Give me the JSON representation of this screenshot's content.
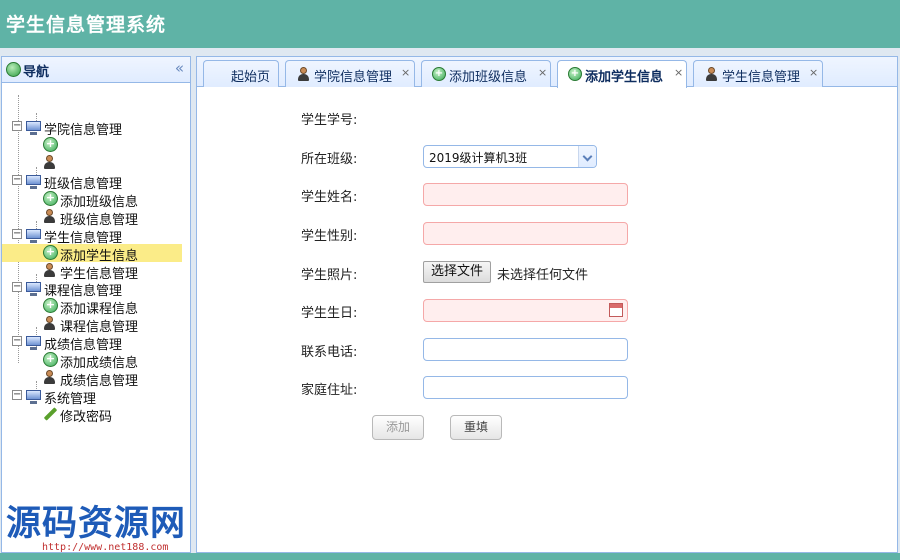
{
  "app": {
    "title": "学生信息管理系统"
  },
  "nav": {
    "title": "导航",
    "collapse_icon": "double-chevron-left-icon",
    "tree": [
      {
        "label": "学院信息管理",
        "children": [
          "",
          ""
        ]
      },
      {
        "label": "班级信息管理",
        "children": [
          "添加班级信息",
          "班级信息管理"
        ]
      },
      {
        "label": "学生信息管理",
        "children": [
          "添加学生信息",
          "学生信息管理"
        ],
        "selected_child": "添加学生信息"
      },
      {
        "label": "课程信息管理",
        "children": [
          "添加课程信息",
          "课程信息管理"
        ]
      },
      {
        "label": "成绩信息管理",
        "children": [
          "添加成绩信息",
          "成绩信息管理"
        ]
      },
      {
        "label": "系统管理",
        "children": [
          "修改密码"
        ]
      }
    ]
  },
  "tabs": [
    {
      "label": "起始页",
      "icon": "",
      "closable": false
    },
    {
      "label": "学院信息管理",
      "icon": "user-icon",
      "closable": true
    },
    {
      "label": "添加班级信息",
      "icon": "add-icon",
      "closable": true
    },
    {
      "label": "添加学生信息",
      "icon": "add-icon",
      "closable": true,
      "active": true
    },
    {
      "label": "学生信息管理",
      "icon": "user-icon",
      "closable": true
    }
  ],
  "form": {
    "student_id_label": "学生学号:",
    "class_label": "所在班级:",
    "class_value": "2019级计算机3班",
    "name_label": "学生姓名:",
    "gender_label": "学生性别:",
    "photo_label": "学生照片:",
    "photo_button": "选择文件",
    "photo_status": "未选择任何文件",
    "birthday_label": "学生生日:",
    "phone_label": "联系电话:",
    "address_label": "家庭住址:",
    "add_button": "添加",
    "reset_button": "重填"
  },
  "watermark": {
    "text": "源码资源网",
    "url": "http://www.net188.com"
  },
  "colors": {
    "header": "#5fb3a6",
    "panel_border": "#95b8e7",
    "selected": "#fbec88",
    "invalid_field": "#ffeeee"
  }
}
